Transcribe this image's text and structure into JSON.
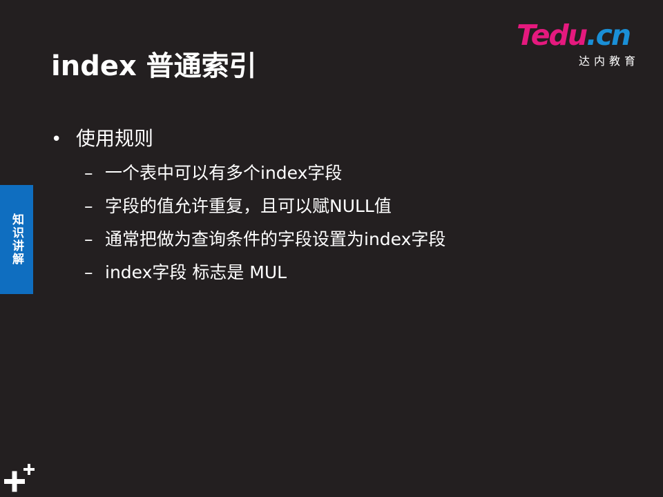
{
  "title": "index 普通索引",
  "logo": {
    "brand_t": "T",
    "brand_edu": "edu",
    "brand_dot": ".",
    "brand_cn": "cn",
    "subtitle": "达内教育"
  },
  "side_tab": {
    "label": "知识讲解"
  },
  "bullet": {
    "symbol": "•",
    "text": "使用规则"
  },
  "sub_items": [
    {
      "symbol": "–",
      "text": "一个表中可以有多个index字段"
    },
    {
      "symbol": "–",
      "text": "字段的值允许重复，且可以赋NULL值"
    },
    {
      "symbol": "–",
      "text": "通常把做为查询条件的字段设置为index字段"
    },
    {
      "symbol": "–",
      "text": "index字段 标志是 MUL"
    }
  ],
  "colors": {
    "background": "#231f20",
    "side_tab": "#0f6ec0",
    "logo_magenta": "#e5197e",
    "logo_blue": "#1a8fd6"
  },
  "icons": {
    "corner_logo": "plus-plus-icon"
  }
}
